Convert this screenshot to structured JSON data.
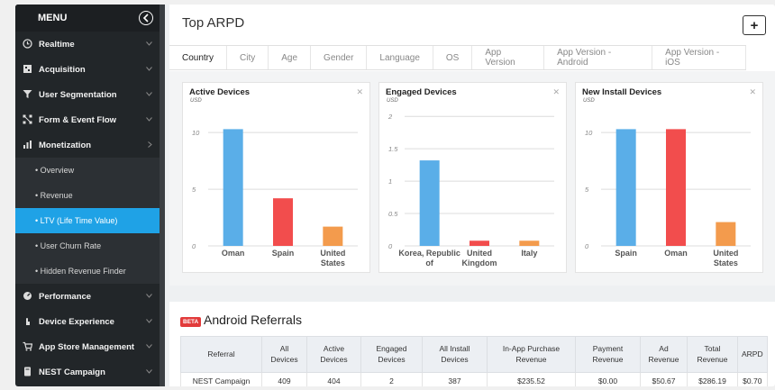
{
  "sidebar": {
    "menu_label": "MENU",
    "items": [
      {
        "label": "Realtime",
        "icon": "clock-icon"
      },
      {
        "label": "Acquisition",
        "icon": "acquisition-icon"
      },
      {
        "label": "User Segmentation",
        "icon": "filter-icon"
      },
      {
        "label": "Form & Event Flow",
        "icon": "flow-icon"
      },
      {
        "label": "Monetization",
        "icon": "monetization-icon"
      }
    ],
    "sub_items": [
      {
        "label": "• Overview"
      },
      {
        "label": "• Revenue"
      },
      {
        "label": "• LTV (Life Time Value)"
      },
      {
        "label": "• User Churn Rate"
      },
      {
        "label": "• Hidden Revenue Finder"
      }
    ],
    "lower_items": [
      {
        "label": "Performance",
        "icon": "gauge-icon"
      },
      {
        "label": "Device Experience",
        "icon": "hand-icon"
      },
      {
        "label": "App Store Management",
        "icon": "cart-icon"
      },
      {
        "label": "NEST Campaign",
        "icon": "campaign-icon"
      }
    ]
  },
  "top_card": {
    "title": "Top ARPD",
    "add_label": "+",
    "tabs": [
      "Country",
      "City",
      "Age",
      "Gender",
      "Language",
      "OS",
      "App Version",
      "App Version - Android",
      "App Version - iOS"
    ]
  },
  "colors": {
    "blue": "#5aaee8",
    "red": "#f24d4d",
    "orange": "#f39b4d",
    "active_nav": "#1fa2e6"
  },
  "chart_data": [
    {
      "type": "bar",
      "title": "Active Devices",
      "unit": "USD",
      "categories": [
        "Oman",
        "Spain",
        "United States"
      ],
      "values": [
        10.3,
        4.2,
        1.7
      ],
      "colors": [
        "#5aaee8",
        "#f24d4d",
        "#f39b4d"
      ],
      "yticks": [
        0,
        5,
        10
      ],
      "ylim": [
        0,
        12
      ]
    },
    {
      "type": "bar",
      "title": "Engaged Devices",
      "unit": "USD",
      "categories": [
        "Korea, Republic of",
        "United Kingdom",
        "Italy"
      ],
      "values": [
        1.32,
        0.08,
        0.08
      ],
      "colors": [
        "#5aaee8",
        "#f24d4d",
        "#f39b4d"
      ],
      "yticks": [
        0,
        0.5,
        1,
        1.5,
        2
      ],
      "ylim": [
        0,
        2.1
      ]
    },
    {
      "type": "bar",
      "title": "New Install Devices",
      "unit": "USD",
      "categories": [
        "Spain",
        "Oman",
        "United States"
      ],
      "values": [
        10.3,
        10.3,
        2.1
      ],
      "colors": [
        "#5aaee8",
        "#f24d4d",
        "#f39b4d"
      ],
      "yticks": [
        0,
        5,
        10
      ],
      "ylim": [
        0,
        12
      ]
    }
  ],
  "bottom_card": {
    "badge": "BETA",
    "title": "Android Referrals",
    "columns": [
      "Referral",
      "All Devices",
      "Active Devices",
      "Engaged Devices",
      "All Install Devices",
      "In-App Purchase Revenue",
      "Payment Revenue",
      "Ad Revenue",
      "Total Revenue",
      "ARPD"
    ],
    "rows": [
      [
        "NEST Campaign",
        "409",
        "404",
        "2",
        "387",
        "$235.52",
        "$0.00",
        "$50.67",
        "$286.19",
        "$0.70"
      ]
    ]
  }
}
